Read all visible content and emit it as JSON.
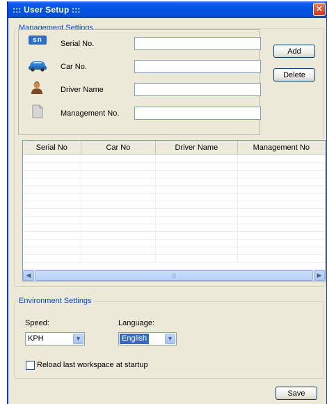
{
  "window": {
    "title": "::: User Setup :::",
    "close_glyph": "✕"
  },
  "management": {
    "legend": "Management Settings",
    "fields": [
      {
        "label": "Serial No.",
        "icon": "sn-badge-icon",
        "value": ""
      },
      {
        "label": "Car No.",
        "icon": "car-icon",
        "value": ""
      },
      {
        "label": "Driver Name",
        "icon": "driver-icon",
        "value": ""
      },
      {
        "label": "Management No.",
        "icon": "document-icon",
        "value": ""
      }
    ],
    "add_label": "Add",
    "delete_label": "Delete",
    "sn_badge_text": "sn"
  },
  "table": {
    "columns": [
      "Serial No",
      "Car No",
      "Driver Name",
      "Management No"
    ],
    "rows": []
  },
  "environment": {
    "legend": "Environment Settings",
    "speed_label": "Speed:",
    "speed_value": "KPH",
    "language_label": "Language:",
    "language_value": "English",
    "reload_label": "Reload last workspace at startup",
    "reload_checked": false
  },
  "save_label": "Save",
  "colors": {
    "title_bar": "#0052e3",
    "legend_text": "#0046d5",
    "window_bg": "#ece9d8"
  }
}
